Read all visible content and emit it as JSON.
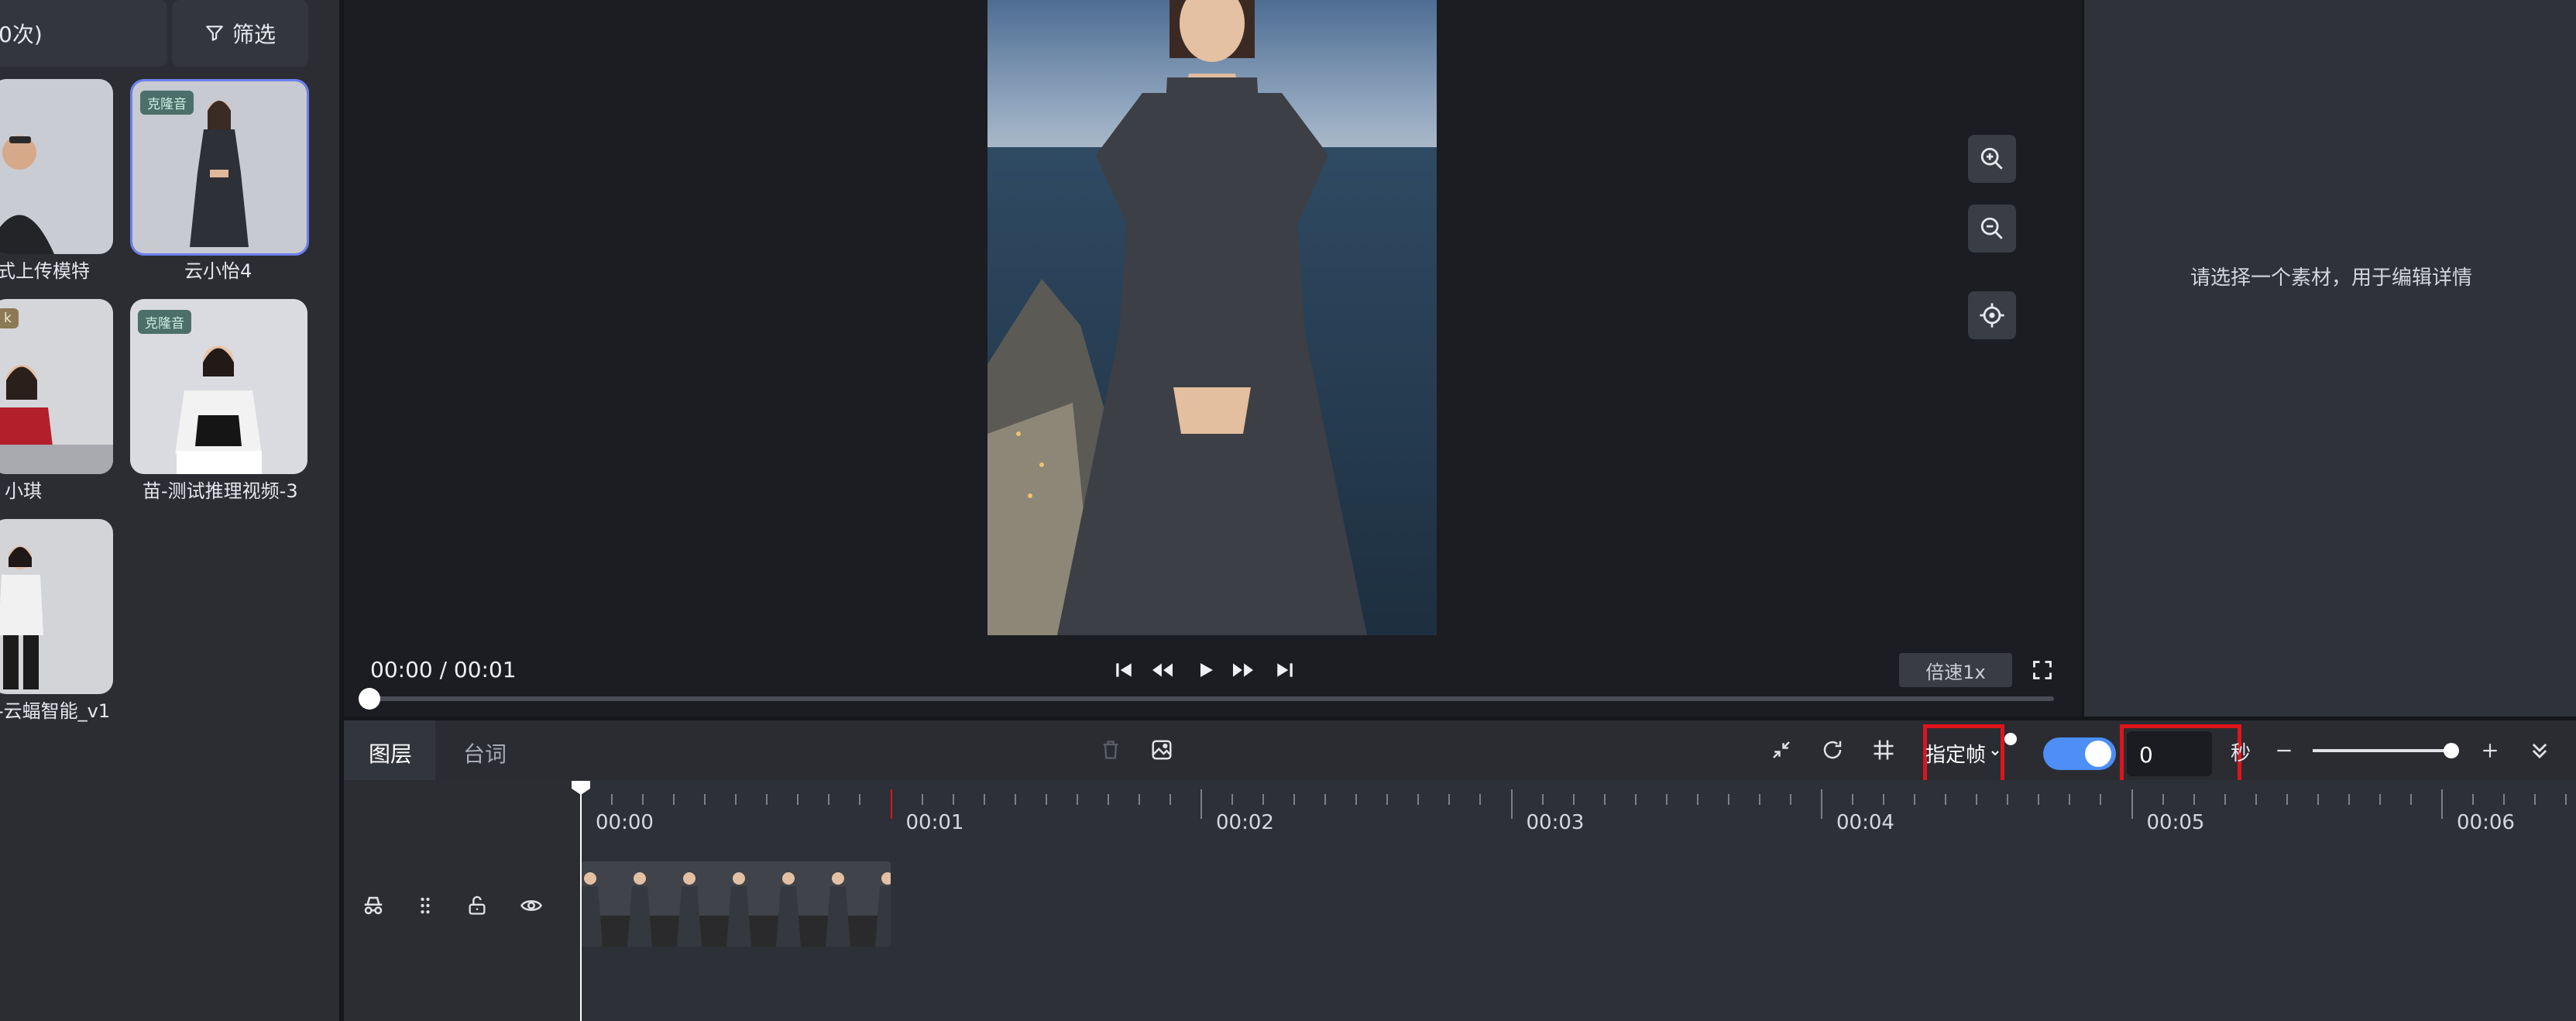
{
  "left_panel": {
    "count_button": "0次)",
    "filter_button": "筛选",
    "materials": [
      {
        "label": "式上传模特",
        "badge": ""
      },
      {
        "label": "云小怡4",
        "badge": "克隆音"
      },
      {
        "label": "小琪",
        "badge": "k"
      },
      {
        "label": "苗-测试推理视频-3",
        "badge": "克隆音"
      },
      {
        "label": "-云蝠智能_v1",
        "badge": ""
      }
    ]
  },
  "player": {
    "time": "00:00 / 00:01",
    "speed_button": "倍速1x"
  },
  "right_panel": {
    "placeholder": "请选择一个素材，用于编辑详情"
  },
  "timeline": {
    "tabs": [
      "图层",
      "台词"
    ],
    "frame_mode_label": "指定帧",
    "frame_value": "0",
    "seconds_unit": "秒",
    "ruler_labels": [
      "00:00",
      "00:01",
      "00:02",
      "00:03",
      "00:04",
      "00:05",
      "00:06"
    ],
    "toggle_on": true
  },
  "colors": {
    "accent": "#4d8ef7",
    "highlight_box": "#e0141b",
    "selected_card_border": "#6c7ff0"
  }
}
